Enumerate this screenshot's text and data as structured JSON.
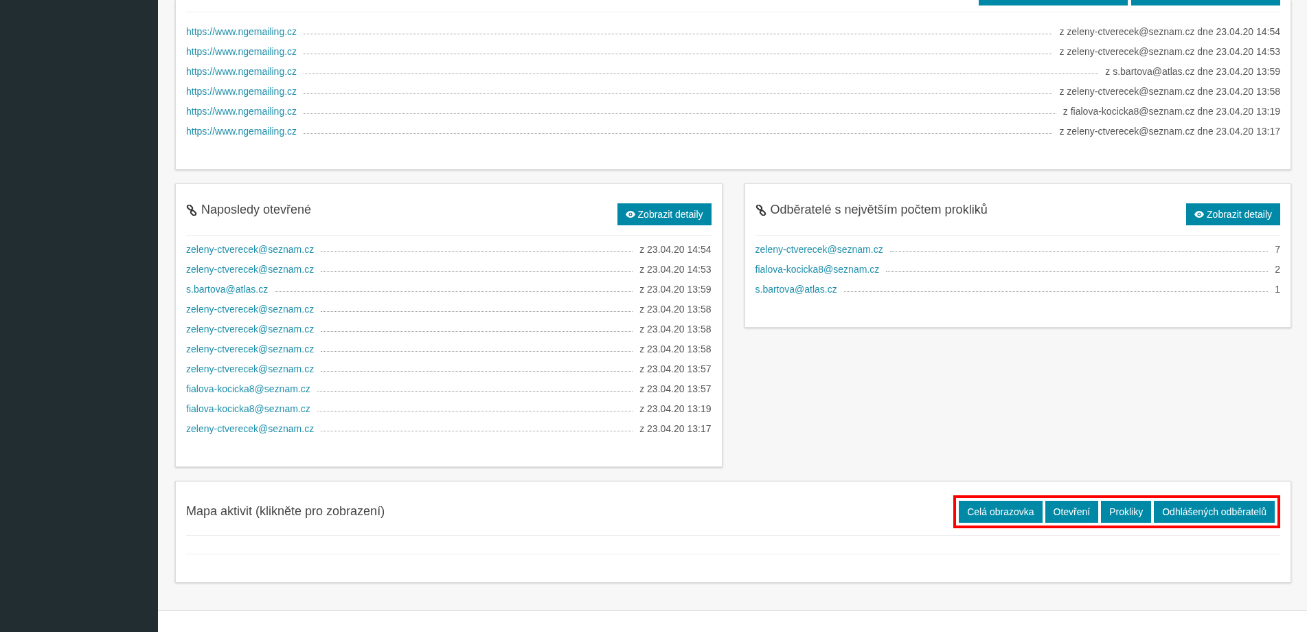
{
  "top_panel": {
    "rows": [
      {
        "link": "https://www.ngemailing.cz",
        "info": "z zeleny-ctverecek@seznam.cz dne 23.04.20 14:54"
      },
      {
        "link": "https://www.ngemailing.cz",
        "info": "z zeleny-ctverecek@seznam.cz dne 23.04.20 14:53"
      },
      {
        "link": "https://www.ngemailing.cz",
        "info": "z s.bartova@atlas.cz dne 23.04.20 13:59"
      },
      {
        "link": "https://www.ngemailing.cz",
        "info": "z zeleny-ctverecek@seznam.cz dne 23.04.20 13:58"
      },
      {
        "link": "https://www.ngemailing.cz",
        "info": "z fialova-kocicka8@seznam.cz dne 23.04.20 13:19"
      },
      {
        "link": "https://www.ngemailing.cz",
        "info": "z zeleny-ctverecek@seznam.cz dne 23.04.20 13:17"
      }
    ]
  },
  "recently_opened": {
    "title": "Naposledy otevřené",
    "button": "Zobrazit detaily",
    "rows": [
      {
        "email": "zeleny-ctverecek@seznam.cz",
        "value": "z 23.04.20 14:54"
      },
      {
        "email": "zeleny-ctverecek@seznam.cz",
        "value": "z 23.04.20 14:53"
      },
      {
        "email": "s.bartova@atlas.cz",
        "value": "z 23.04.20 13:59"
      },
      {
        "email": "zeleny-ctverecek@seznam.cz",
        "value": "z 23.04.20 13:58"
      },
      {
        "email": "zeleny-ctverecek@seznam.cz",
        "value": "z 23.04.20 13:58"
      },
      {
        "email": "zeleny-ctverecek@seznam.cz",
        "value": "z 23.04.20 13:58"
      },
      {
        "email": "zeleny-ctverecek@seznam.cz",
        "value": "z 23.04.20 13:57"
      },
      {
        "email": "fialova-kocicka8@seznam.cz",
        "value": "z 23.04.20 13:57"
      },
      {
        "email": "fialova-kocicka8@seznam.cz",
        "value": "z 23.04.20 13:19"
      },
      {
        "email": "zeleny-ctverecek@seznam.cz",
        "value": "z 23.04.20 13:17"
      }
    ]
  },
  "top_clickers": {
    "title": "Odběratelé s největším počtem prokliků",
    "button": "Zobrazit detaily",
    "rows": [
      {
        "email": "zeleny-ctverecek@seznam.cz",
        "value": "7"
      },
      {
        "email": "fialova-kocicka8@seznam.cz",
        "value": "2"
      },
      {
        "email": "s.bartova@atlas.cz",
        "value": "1"
      }
    ]
  },
  "activity_map": {
    "title": "Mapa aktivit (klikněte pro zobrazení)",
    "buttons_highlighted": true,
    "buttons": [
      "Celá obrazovka",
      "Otevření",
      "Prokliky",
      "Odhlášených odběratelů"
    ]
  }
}
